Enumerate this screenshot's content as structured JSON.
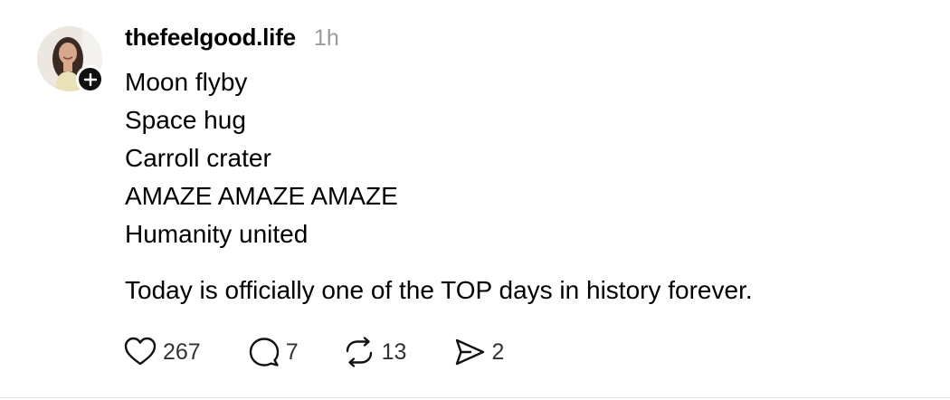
{
  "post": {
    "username": "thefeelgood.life",
    "time": "1h",
    "lines": [
      "Moon flyby",
      "Space hug",
      "Carroll crater",
      "AMAZE AMAZE AMAZE",
      "Humanity united"
    ],
    "paragraph": "Today is officially one of the TOP days in history forever."
  },
  "actions": {
    "likes": "267",
    "replies": "7",
    "reposts": "13",
    "shares": "2"
  },
  "icons": {
    "like": "heart-icon",
    "reply": "speech-bubble-icon",
    "repost": "repost-arrows-icon",
    "share": "send-icon",
    "follow": "plus-icon"
  }
}
